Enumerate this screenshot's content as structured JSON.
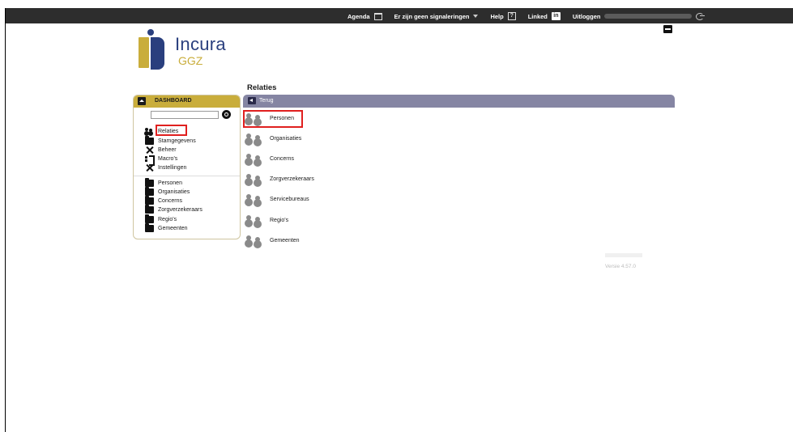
{
  "topbar": {
    "agenda": "Agenda",
    "signals": "Er zijn geen signaleringen",
    "help": "Help",
    "linked": "Linked",
    "linkedin_badge": "in",
    "logout": "Uitloggen"
  },
  "logo": {
    "line1": "Incura",
    "line2": "GGZ"
  },
  "sidebar": {
    "title": "DASHBOARD",
    "search_placeholder": "",
    "menu": [
      {
        "label": "Relaties",
        "icon": "people-icon"
      },
      {
        "label": "Stamgegevens",
        "icon": "folder-icon"
      },
      {
        "label": "Beheer",
        "icon": "tools-icon"
      },
      {
        "label": "Macro's",
        "icon": "macro-icon"
      },
      {
        "label": "Instellingen",
        "icon": "tools-icon"
      }
    ],
    "sub_menu": [
      {
        "label": "Personen"
      },
      {
        "label": "Organisaties"
      },
      {
        "label": "Concerns"
      },
      {
        "label": "Zorgverzekeraars"
      },
      {
        "label": "Regio's"
      },
      {
        "label": "Gemeenten"
      }
    ]
  },
  "main": {
    "title": "Relaties",
    "back_label": "Terug",
    "items": [
      {
        "label": "Personen"
      },
      {
        "label": "Organisaties"
      },
      {
        "label": "Concerns"
      },
      {
        "label": "Zorgverzekeraars"
      },
      {
        "label": "Servicebureaus"
      },
      {
        "label": "Regio's"
      },
      {
        "label": "Gemeenten"
      }
    ]
  },
  "version": "Versie 4.57.0",
  "colors": {
    "topbar": "#2d2d2d",
    "gold": "#c9ad3b",
    "navy": "#2a3f7e",
    "panel_header": "#8585a3",
    "highlight": "#e0201f"
  }
}
